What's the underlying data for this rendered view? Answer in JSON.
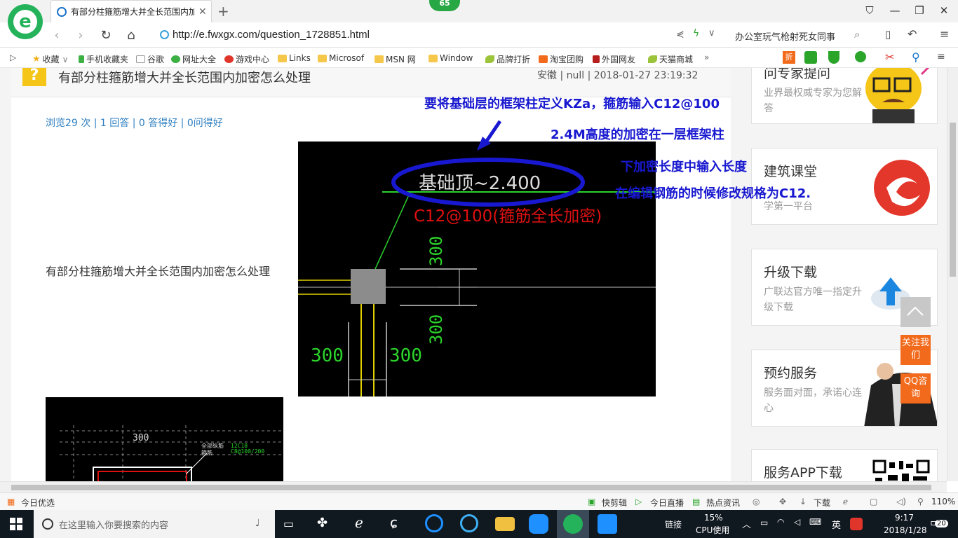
{
  "browser": {
    "tab_title": "有部分柱箍筋增大并全长范围内加",
    "badge": "65",
    "url": "http://e.fwxgx.com/question_1728851.html",
    "search_text": "办公室玩气枪射死女同事"
  },
  "bookmarks": [
    {
      "label": "收藏",
      "icon": "star-icon"
    },
    {
      "label": "手机收藏夹",
      "icon": "phone-icon"
    },
    {
      "label": "谷歌",
      "icon": "doc-icon"
    },
    {
      "label": "网址大全",
      "icon": "globe-icon"
    },
    {
      "label": "游戏中心",
      "icon": "game-icon"
    },
    {
      "label": "Links",
      "icon": "folder-icon"
    },
    {
      "label": "Microsof",
      "icon": "folder-icon"
    },
    {
      "label": "MSN 网",
      "icon": "folder-icon"
    },
    {
      "label": "Window",
      "icon": "folder-icon"
    },
    {
      "label": "品牌打折",
      "icon": "leaf-icon"
    },
    {
      "label": "淘宝团购",
      "icon": "taobao-icon"
    },
    {
      "label": "外国网友",
      "icon": "flag-icon"
    },
    {
      "label": "天猫商城",
      "icon": "leaf-icon"
    }
  ],
  "question": {
    "title": "有部分柱箍筋增大并全长范围内加密怎么处理",
    "meta": "安徽 | null | 2018-01-27 23:19:32",
    "stats": "浏览29 次 | 1 回答 | 0 答得好 | 0问得好",
    "body": "有部分柱箍筋增大并全长范围内加密怎么处理"
  },
  "cad": {
    "label_top": "基础顶~2.400",
    "label_red": "C12@100(箍筋全长加密)",
    "dim_300_a": "300",
    "dim_300_b": "300",
    "dim_300_c": "300",
    "dim_300_d": "300",
    "small_dim": "300",
    "small_label_1": "全部纵筋",
    "small_label_2": "箍筋",
    "small_code_1": "12C18",
    "small_code_2": "C8@100/200"
  },
  "annotations": {
    "line1": "要将基础层的框架柱定义KZa，箍筋输入C12@100",
    "line2": "2.4M高度的加密在一层框架柱",
    "line3": "下加密长度中输入长度",
    "line4": "在编辑钢筋的时候修改规格为C12."
  },
  "sidebar": {
    "card1_title": "问专家提问",
    "card1_sub": "业界最权威专家为您解答",
    "card2_title": "建筑课堂",
    "card2_sub": "学第一平台",
    "card3_title": "升级下载",
    "card3_sub": "广联达官方唯一指定升级下载",
    "card4_title": "预约服务",
    "card4_sub": "服务面对面，承诺心连心",
    "card5_title": "服务APP下载",
    "follow_label": "关注我们",
    "qq_label": "QQ咨询"
  },
  "statusbar": {
    "left": "今日优选",
    "kuaijianji": "快剪辑",
    "live": "今日直播",
    "news": "热点资讯",
    "download": "下载",
    "zoom": "110%"
  },
  "taskbar": {
    "search_placeholder": "在这里输入你要搜索的内容",
    "link_label": "链接",
    "cpu_percent": "15%",
    "cpu_label": "CPU使用",
    "ime": "英",
    "time": "9:17",
    "date": "2018/1/28",
    "notifications": "20"
  },
  "colors": {
    "annotation": "#1818d0",
    "cad_green": "#2bd32b",
    "cad_red": "#e01010",
    "accent_orange": "#f26a1b",
    "logo_green": "#24b35a"
  }
}
